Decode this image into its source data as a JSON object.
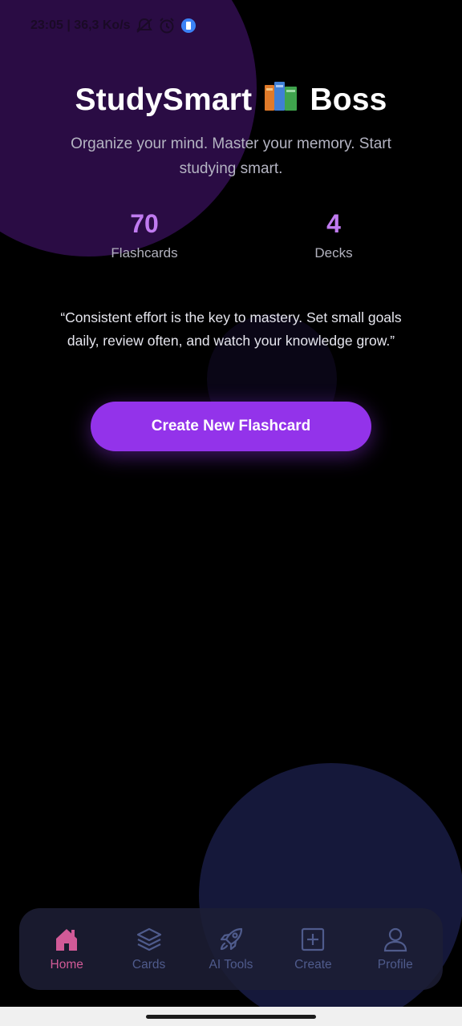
{
  "status_bar": {
    "text": "23:05 | 36,3 Ko/s",
    "icons": [
      "muted-notification-icon",
      "alarm-icon",
      "app-badge-icon"
    ]
  },
  "hero": {
    "title_main": "StudySmart",
    "title_emoji_icon": "books-icon",
    "title_suffix": "Boss",
    "subtitle": "Organize your mind. Master your memory. Start studying smart."
  },
  "stats": [
    {
      "value": "70",
      "label": "Flashcards"
    },
    {
      "value": "4",
      "label": "Decks"
    }
  ],
  "quote": "“Consistent effort is the key to mastery. Set small goals daily, review often, and watch your knowledge grow.”",
  "cta": {
    "label": "Create New Flashcard"
  },
  "nav": {
    "active": "home",
    "items": [
      {
        "id": "home",
        "label": "Home",
        "icon": "home-icon"
      },
      {
        "id": "cards",
        "label": "Cards",
        "icon": "layers-icon"
      },
      {
        "id": "ai-tools",
        "label": "AI Tools",
        "icon": "rocket-icon"
      },
      {
        "id": "create",
        "label": "Create",
        "icon": "plus-square-icon"
      },
      {
        "id": "profile",
        "label": "Profile",
        "icon": "user-icon"
      }
    ]
  },
  "colors": {
    "background": "#000000",
    "accent": "#9333ea",
    "stat_value": "#c07bf0",
    "nav_active": "#d15a97",
    "nav_inactive": "#4f5b8c"
  }
}
